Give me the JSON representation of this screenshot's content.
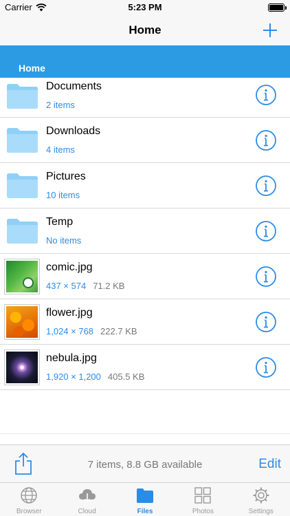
{
  "status_bar": {
    "carrier": "Carrier",
    "time": "5:23 PM"
  },
  "nav": {
    "title": "Home",
    "add_icon": "plus-icon"
  },
  "path": {
    "label": "Home"
  },
  "files": [
    {
      "name": "Documents",
      "count": "2 items",
      "size": "",
      "kind": "folder"
    },
    {
      "name": "Downloads",
      "count": "4 items",
      "size": "",
      "kind": "folder"
    },
    {
      "name": "Pictures",
      "count": "10 items",
      "size": "",
      "kind": "folder"
    },
    {
      "name": "Temp",
      "count": "No items",
      "size": "",
      "kind": "folder"
    },
    {
      "name": "comic.jpg",
      "count": "437 × 574",
      "size": "71.2 KB",
      "kind": "image"
    },
    {
      "name": "flower.jpg",
      "count": "1,024 × 768",
      "size": "222.7 KB",
      "kind": "image"
    },
    {
      "name": "nebula.jpg",
      "count": "1,920 × 1,200",
      "size": "405.5 KB",
      "kind": "image"
    }
  ],
  "toolbar": {
    "status": "7 items, 8.8 GB available",
    "edit_label": "Edit",
    "share_icon": "share-icon"
  },
  "tabs": [
    {
      "label": "Browser",
      "icon": "globe-icon",
      "active": false
    },
    {
      "label": "Cloud",
      "icon": "cloud-icon",
      "active": false
    },
    {
      "label": "Files",
      "icon": "folder-icon",
      "active": true
    },
    {
      "label": "Photos",
      "icon": "grid-icon",
      "active": false
    },
    {
      "label": "Settings",
      "icon": "gear-icon",
      "active": false
    }
  ],
  "colors": {
    "accent": "#2a8ce8",
    "path_bar": "#2d9be4",
    "folder": "#8fd0f7"
  }
}
